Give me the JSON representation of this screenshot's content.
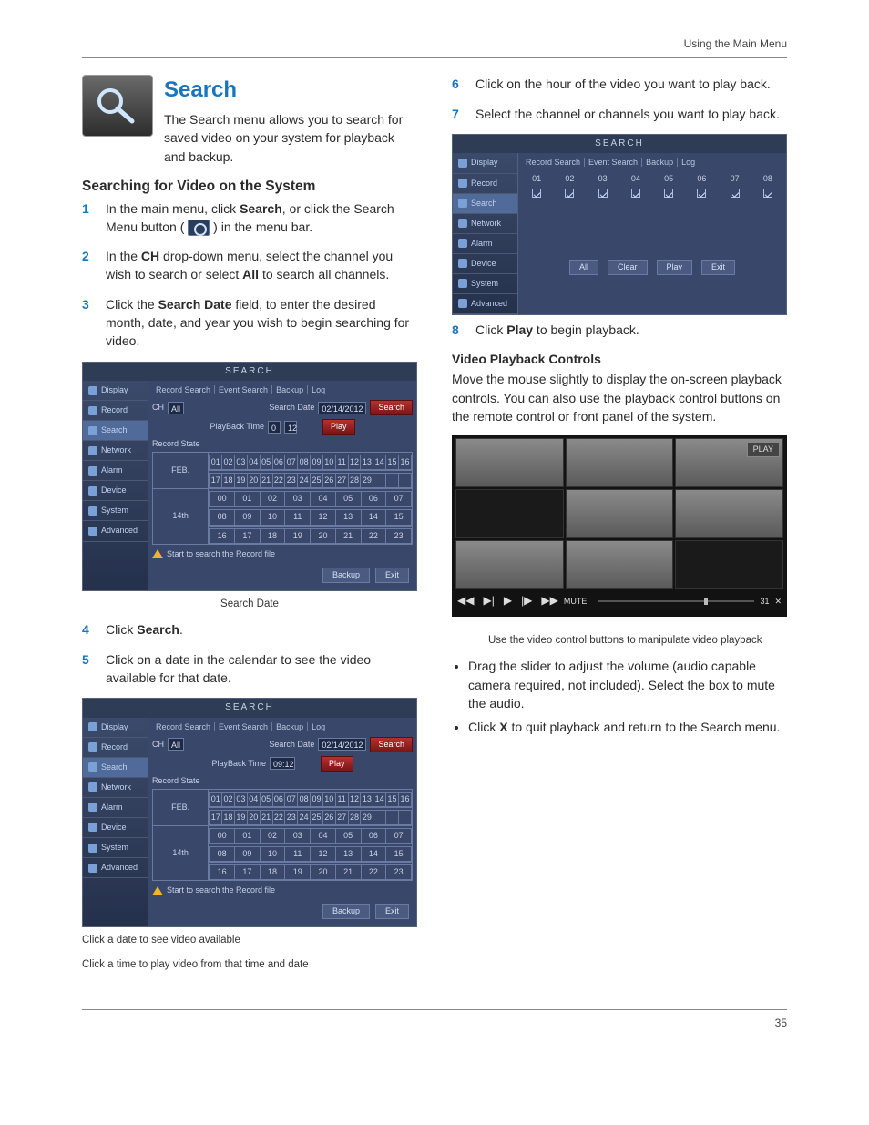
{
  "header": {
    "section": "Using the Main Menu"
  },
  "page_number": "35",
  "left": {
    "h1": "Search",
    "intro": "The Search menu allows you to search for saved video on your system for playback and backup.",
    "h2": "Searching for Video on the System",
    "step1_a": "In the main menu, click ",
    "step1_b": "Search",
    "step1_c": ", or click the Search Menu button ( ",
    "step1_d": " ) in the menu bar.",
    "step2_a": "In the ",
    "step2_b": "CH",
    "step2_c": " drop-down menu, select the channel you wish to search or select ",
    "step2_d": "All",
    "step2_e": " to search all channels.",
    "step3_a": "Click the ",
    "step3_b": "Search Date",
    "step3_c": " field, to enter the desired month, date, and year you wish to begin searching for video.",
    "caption1": "Search Date",
    "step4_a": "Click ",
    "step4_b": "Search",
    "step4_c": ".",
    "step5": "Click on a date in the calendar to see the video available for that date.",
    "caption2": "Click a date to see video available",
    "caption3": "Click a time to play video from that time and date"
  },
  "right": {
    "step6": "Click on the hour of the video you want to play back.",
    "step7": "Select the channel or channels you want to play back.",
    "step8_a": "Click ",
    "step8_b": "Play",
    "step8_c": " to begin playback.",
    "h3": "Video Playback Controls",
    "para": "Move the mouse slightly to display the on-screen playback controls. You can also use the playback control buttons on the remote control or front panel of the system.",
    "caption_play": "Use the video control buttons to manipulate video playback",
    "bullet1": "Drag the slider to adjust the volume (audio capable camera required, not included). Select the box to mute the audio.",
    "bullet2_a": "Click ",
    "bullet2_b": "X",
    "bullet2_c": " to quit playback and return to the Search menu."
  },
  "dvr": {
    "title": "SEARCH",
    "sidebar": [
      "Display",
      "Record",
      "Search",
      "Network",
      "Alarm",
      "Device",
      "System",
      "Advanced"
    ],
    "tabs": [
      "Record Search",
      "Event Search",
      "Backup",
      "Log"
    ],
    "ch_label": "CH",
    "ch_value": "All",
    "sd_label": "Search Date",
    "sd_value": "02/14/2012",
    "search_btn": "Search",
    "pb_label": "PlayBack Time",
    "pb_value_a": "0",
    "pb_value_b": "12",
    "pb_value2": "09:12",
    "play_btn": "Play",
    "rec_state": "Record State",
    "month": "FEB.",
    "week_label": "14th",
    "status_msg": "Start to search the Record file",
    "backup_btn": "Backup",
    "exit_btn": "Exit",
    "all_btn": "All",
    "clear_btn": "Clear",
    "channels": [
      "01",
      "02",
      "03",
      "04",
      "05",
      "06",
      "07",
      "08"
    ],
    "cal_row1": [
      "01",
      "02",
      "03",
      "04",
      "05",
      "06",
      "07",
      "08",
      "09",
      "10",
      "11",
      "12",
      "13",
      "14",
      "15",
      "16"
    ],
    "cal_row2": [
      "17",
      "18",
      "19",
      "20",
      "21",
      "22",
      "23",
      "24",
      "25",
      "26",
      "27",
      "28",
      "29",
      "",
      "",
      ""
    ],
    "hr_row1": [
      "00",
      "01",
      "02",
      "03",
      "04",
      "05",
      "06",
      "07"
    ],
    "hr_row2": [
      "08",
      "09",
      "10",
      "11",
      "12",
      "13",
      "14",
      "15"
    ],
    "hr_row3": [
      "16",
      "17",
      "18",
      "19",
      "20",
      "21",
      "22",
      "23"
    ]
  },
  "play": {
    "tag": "PLAY",
    "mute": "MUTE",
    "vol": "31",
    "glyphs": {
      "rw": "◀◀",
      "prev": "▶|",
      "play": "▶",
      "next": "|▶",
      "ff": "▶▶",
      "close": "✕"
    }
  }
}
